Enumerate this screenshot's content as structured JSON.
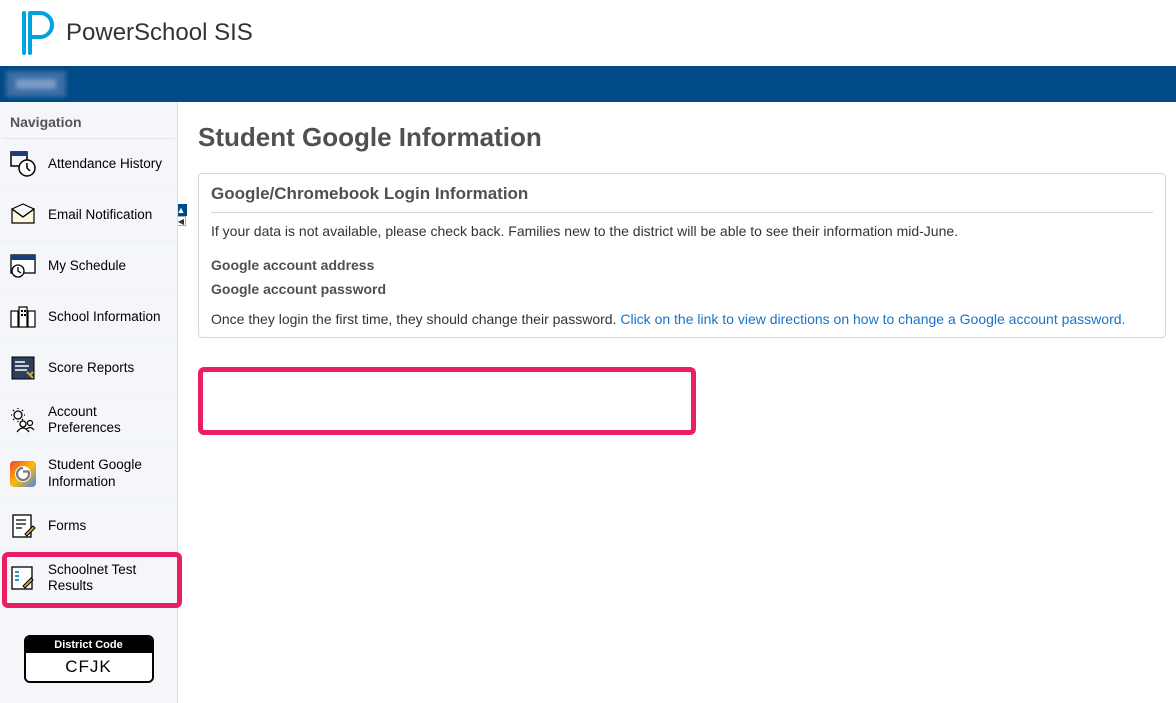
{
  "header": {
    "app_name": "PowerSchool SIS"
  },
  "sidebar": {
    "title": "Navigation",
    "items": [
      {
        "label": "Attendance History"
      },
      {
        "label": "Email Notification"
      },
      {
        "label": "My Schedule"
      },
      {
        "label": "School Information"
      },
      {
        "label": "Score Reports"
      },
      {
        "label": "Account Preferences"
      },
      {
        "label": "Student Google Information"
      },
      {
        "label": "Forms"
      },
      {
        "label": "Schoolnet Test Results"
      }
    ],
    "district": {
      "label": "District Code",
      "code": "CFJK"
    }
  },
  "main": {
    "title": "Student Google Information",
    "card": {
      "title": "Google/Chromebook Login Information",
      "note": "If your data is not available, please check back. Families new to the district will be able to see their information mid-June.",
      "fields": [
        {
          "label": "Google account address",
          "value": "████████████"
        },
        {
          "label": "Google account password",
          "value": "████████"
        }
      ],
      "footer_text": "Once they login the first time, they should change their password. ",
      "footer_link": "Click on the link to view directions on how to change a Google account password."
    }
  }
}
